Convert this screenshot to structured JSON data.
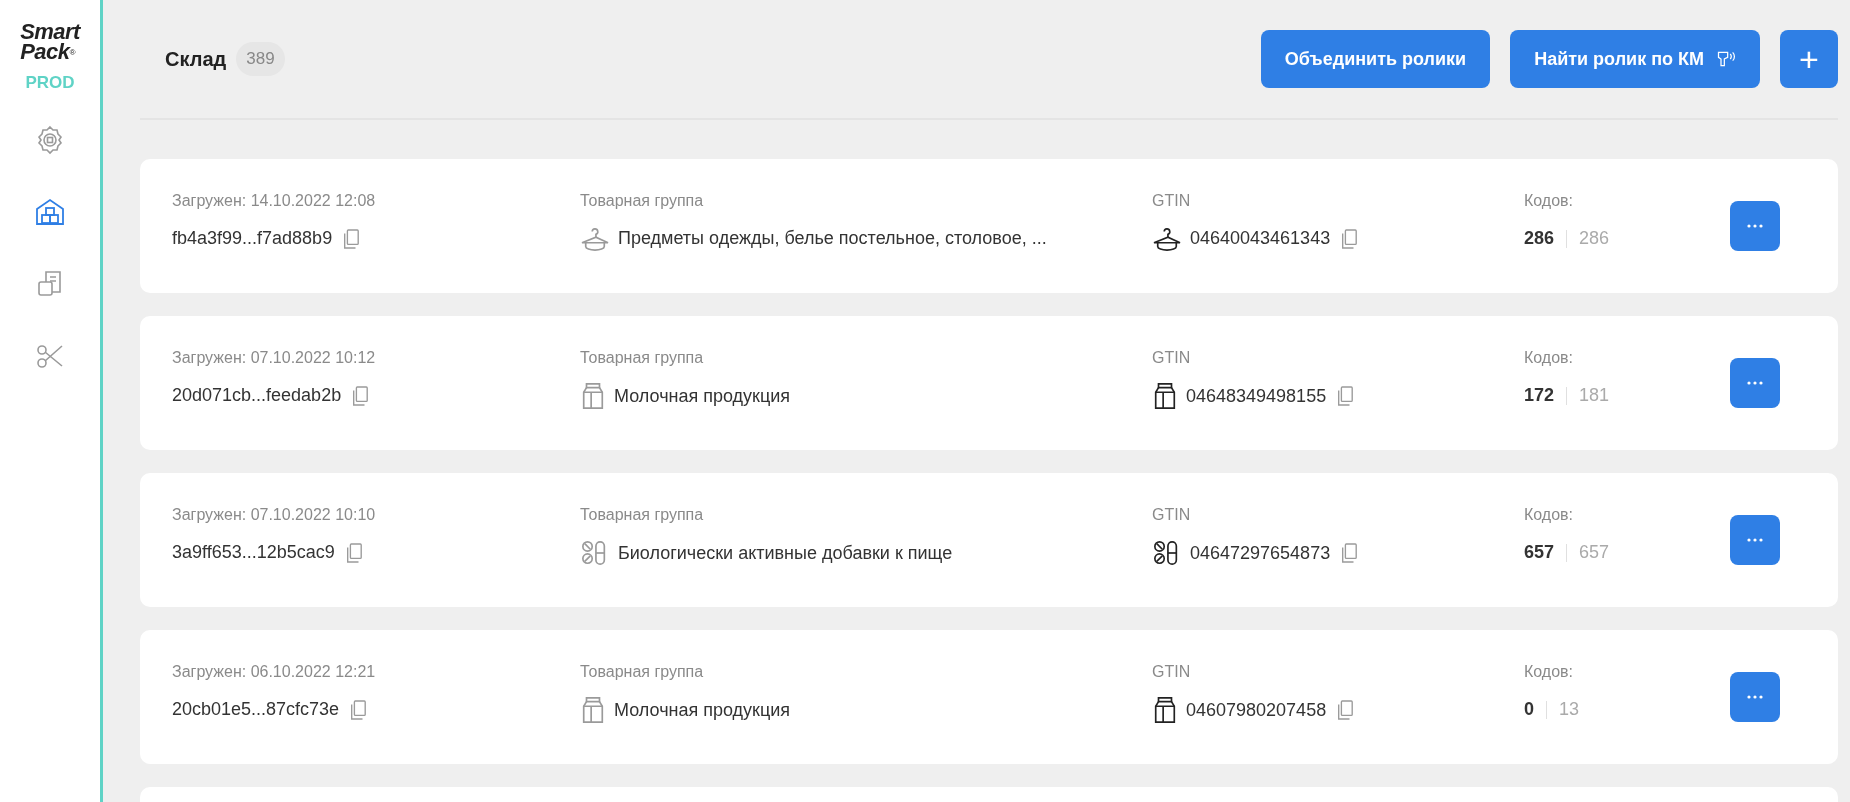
{
  "sidebar": {
    "logo": {
      "line1": "Smart",
      "line2": "Pack",
      "mark": "®"
    },
    "env": "PROD",
    "items": [
      {
        "kind": "gear",
        "selected": false
      },
      {
        "kind": "warehouse",
        "selected": true
      },
      {
        "kind": "documents",
        "selected": false
      },
      {
        "kind": "scissors",
        "selected": false
      }
    ]
  },
  "header": {
    "title": "Склад",
    "count": "389",
    "buttons": [
      {
        "kind": "text",
        "label": "Объединить ролики"
      },
      {
        "kind": "scanner",
        "label": "Найти ролик по КМ"
      },
      {
        "kind": "plus",
        "label": "+"
      }
    ]
  },
  "rolls": [
    {
      "uploaded": "Загружен: 14.10.2022 12:08",
      "hash": "fb4a3f99...f7ad88b9",
      "group_label": "Товарная группа",
      "kind": "clothes",
      "group": "Предметы одежды, белье постельное, столовое, ...",
      "gtin_label": "GTIN",
      "gtin": "04640043461343",
      "codes_label": "Кодов:",
      "codes_done": "286",
      "codes_total": "286"
    },
    {
      "uploaded": "Загружен: 07.10.2022 10:12",
      "hash": "20d071cb...feedab2b",
      "group_label": "Товарная группа",
      "kind": "dairy",
      "group": "Молочная продукция",
      "gtin_label": "GTIN",
      "gtin": "04648349498155",
      "codes_label": "Кодов:",
      "codes_done": "172",
      "codes_total": "181"
    },
    {
      "uploaded": "Загружен: 07.10.2022 10:10",
      "hash": "3a9ff653...12b5cac9",
      "group_label": "Товарная группа",
      "kind": "supplements",
      "group": "Биологически активные добавки к пище",
      "gtin_label": "GTIN",
      "gtin": "04647297654873",
      "codes_label": "Кодов:",
      "codes_done": "657",
      "codes_total": "657"
    },
    {
      "uploaded": "Загружен: 06.10.2022 12:21",
      "hash": "20cb01e5...87cfc73e",
      "group_label": "Товарная группа",
      "kind": "dairy",
      "group": "Молочная продукция",
      "gtin_label": "GTIN",
      "gtin": "04607980207458",
      "codes_label": "Кодов:",
      "codes_done": "0",
      "codes_total": "13"
    }
  ]
}
